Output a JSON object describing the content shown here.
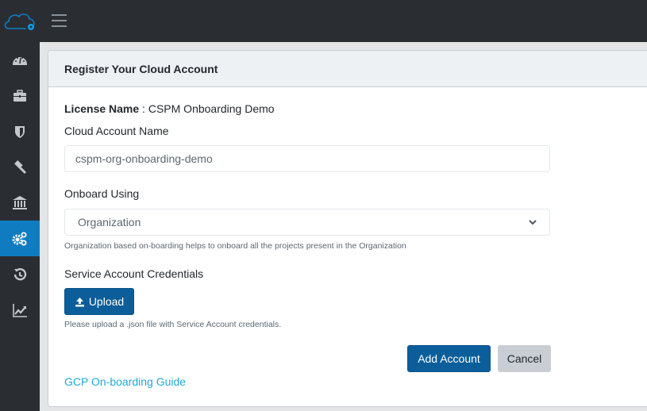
{
  "topbar": {
    "logo_icon": "cloud-gear-icon",
    "menu_icon": "hamburger-icon"
  },
  "sidebar": {
    "items": [
      {
        "icon": "dashboard-icon",
        "active": false
      },
      {
        "icon": "briefcase-icon",
        "active": false
      },
      {
        "icon": "shield-icon",
        "active": false
      },
      {
        "icon": "gavel-icon",
        "active": false
      },
      {
        "icon": "bank-icon",
        "active": false
      },
      {
        "icon": "cogs-icon",
        "active": true
      },
      {
        "icon": "history-icon",
        "active": false
      },
      {
        "icon": "line-chart-icon",
        "active": false
      }
    ]
  },
  "card": {
    "title": "Register Your Cloud Account",
    "license_label": "License Name",
    "license_sep": " : ",
    "license_value": "CSPM Onboarding Demo",
    "account_name_label": "Cloud Account Name",
    "account_name_value": "cspm-org-onboarding-demo",
    "onboard_label": "Onboard Using",
    "onboard_selected": "Organization",
    "onboard_help": "Organization based on-boarding helps to onboard all the projects present in the Organization",
    "credentials_label": "Service Account Credentials",
    "upload_label": "Upload",
    "upload_help": "Please upload a .json file with Service Account credentials.",
    "add_label": "Add Account",
    "cancel_label": "Cancel",
    "guide_link": "GCP On-boarding Guide"
  },
  "colors": {
    "primary": "#0b5e99",
    "active_nav": "#0f7cc1",
    "link": "#20a8d8",
    "sidebar_bg": "#2a2e33"
  }
}
